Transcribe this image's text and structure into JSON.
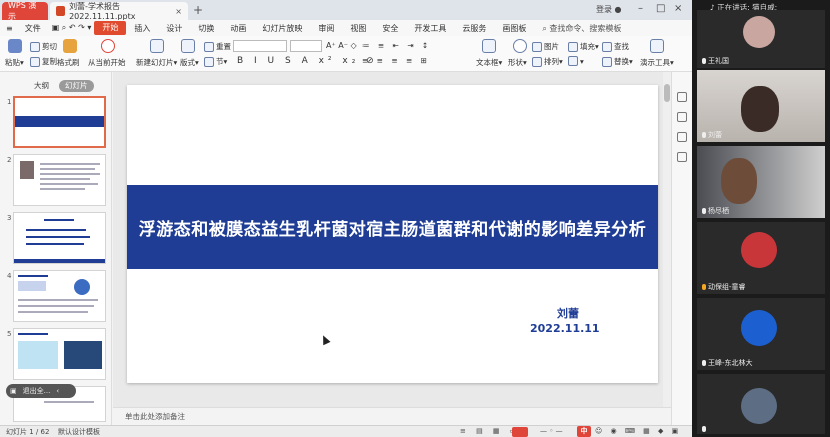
{
  "app": {
    "brand_tab": "WPS 演示",
    "doc_tab": "刘蕾-学术报告2022.11.11.pptx",
    "login": "登录",
    "file_menu": "文件",
    "menus": [
      "开始",
      "插入",
      "设计",
      "切换",
      "动画",
      "幻灯片放映",
      "审阅",
      "视图",
      "安全",
      "开发工具",
      "云服务",
      "画图板"
    ],
    "search_label": "查找命令、搜索模板"
  },
  "ribbon": {
    "paste": "粘贴",
    "cut": "剪切",
    "copy": "复制",
    "format_painter": "格式刷",
    "from_current": "从当前开始",
    "new_slide": "新建幻灯片",
    "layout": "版式",
    "section": "节",
    "reset": "重置",
    "text_box": "文本框",
    "shape": "形状",
    "arrange": "排列",
    "picture": "图片",
    "fill": "填充",
    "find": "查找",
    "replace": "替换",
    "presentation_tools": "演示工具"
  },
  "left_panel": {
    "tab_outline": "大纲",
    "tab_slides": "幻灯片",
    "thumb_numbers": [
      "1",
      "2",
      "3",
      "4",
      "5",
      "6"
    ],
    "pill_text": "退出全..."
  },
  "slide": {
    "title": "浮游态和被膜态益生乳杆菌对宿主肠道菌群和代谢的影响差异分析",
    "author": "刘蕾",
    "date": "2022.11.11"
  },
  "notes_placeholder": "单击此处添加备注",
  "status": {
    "slide_counter": "幻灯片 1 / 62",
    "template": "默认设计模板",
    "ime": "中"
  },
  "meeting": {
    "speaking_label": "正在讲话: 猫自戚;",
    "participants": [
      {
        "name": "王礼国",
        "mic": "off"
      },
      {
        "name": "刘蕾",
        "mic": "off"
      },
      {
        "name": "杨尽栖",
        "mic": "off"
      },
      {
        "name": "动保组-童睿",
        "mic": "on"
      },
      {
        "name": "王峰-东北林大",
        "mic": "off"
      },
      {
        "name": "",
        "mic": "off"
      }
    ]
  },
  "colors": {
    "accent_red": "#e0453a",
    "slide_band": "#1f3d95"
  }
}
